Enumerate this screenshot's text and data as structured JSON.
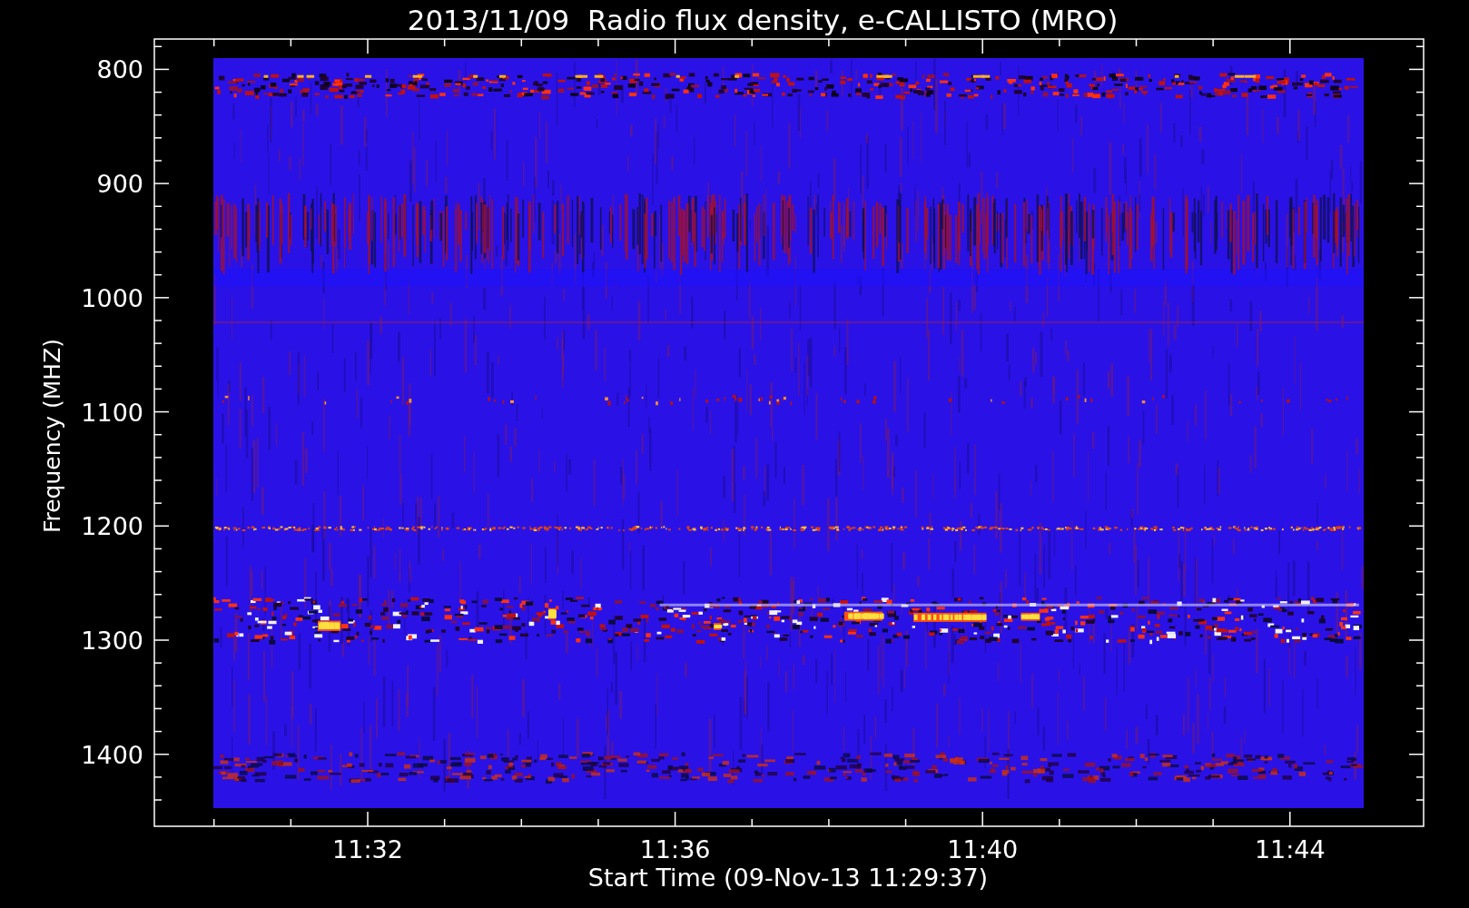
{
  "title": "2013/11/09  Radio flux density, e-CALLISTO (MRO)",
  "plot": {
    "ylabel": "Frequency (MHZ)",
    "yticks": [
      "800",
      "900",
      "1000",
      "1100",
      "1200",
      "1300",
      "1400"
    ],
    "xticks": [
      "11:32",
      "11:36",
      "11:40",
      "11:44"
    ],
    "xlabel": "Start Time (09-Nov-13 11:29:37)"
  }
}
